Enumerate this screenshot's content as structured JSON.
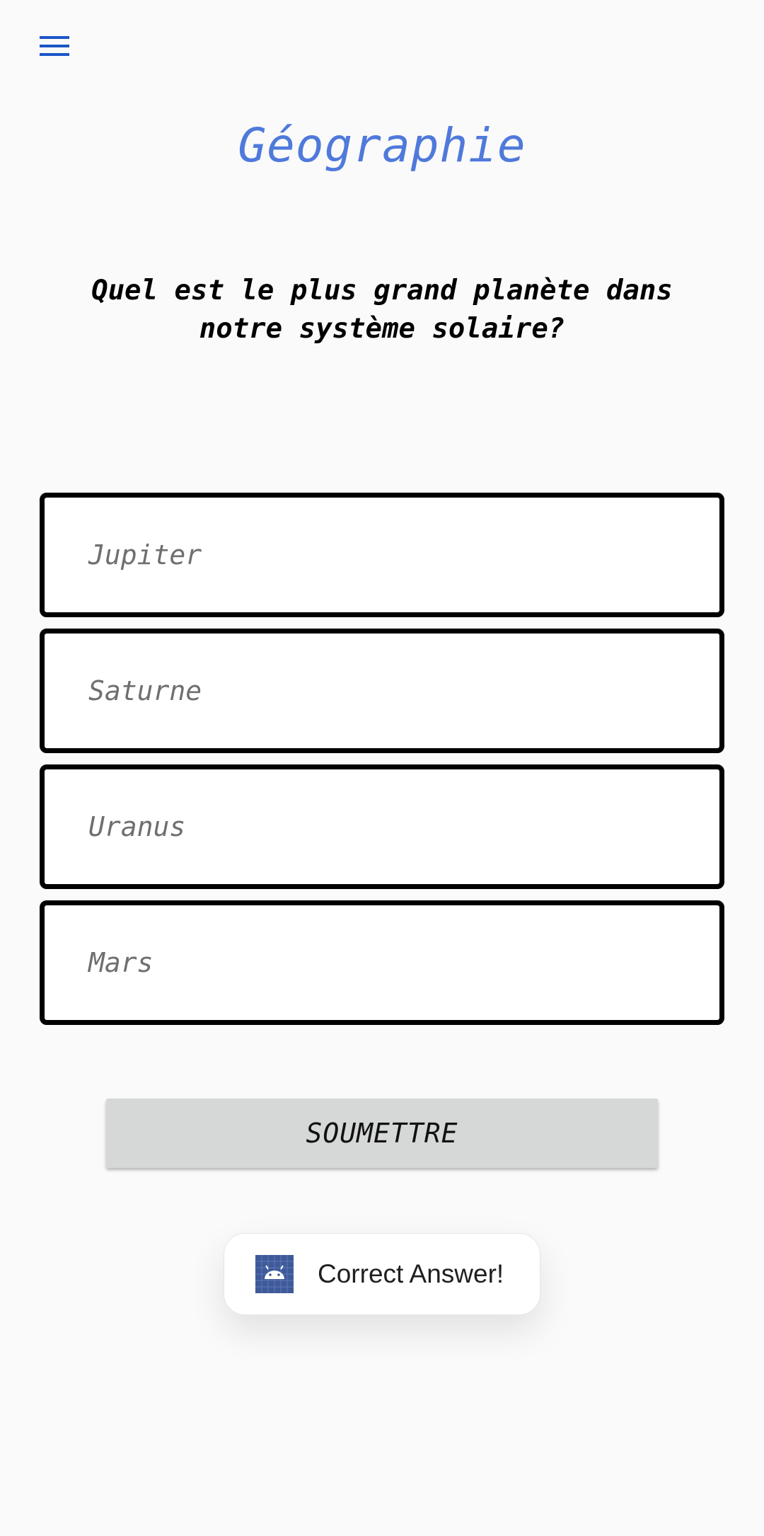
{
  "header": {
    "menu_icon": "hamburger-menu-icon",
    "title": "Géographie"
  },
  "quiz": {
    "question": "Quel est le plus grand planète dans notre système solaire?",
    "options": [
      {
        "label": "Jupiter"
      },
      {
        "label": "Saturne"
      },
      {
        "label": "Uranus"
      },
      {
        "label": "Mars"
      }
    ],
    "submit_label": "SOUMETTRE"
  },
  "toast": {
    "icon": "android-app-icon",
    "message": "Correct Answer!"
  },
  "colors": {
    "background": "#fafafa",
    "title": "#4f79db",
    "menu_icon": "#1a56c8",
    "option_border": "#000000",
    "option_text": "#6f6f6f",
    "button_bg": "#d6d7d7",
    "toast_bg": "#ffffff",
    "app_icon_bg": "#3f5a99"
  }
}
